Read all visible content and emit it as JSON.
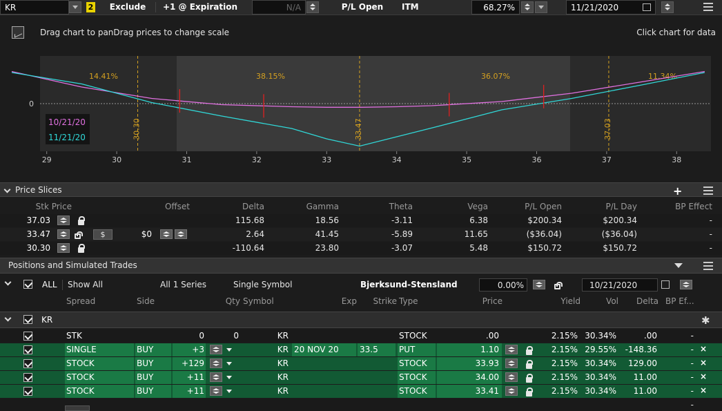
{
  "toolbar": {
    "symbol": "KR",
    "badge": "2",
    "exclude_label": "Exclude",
    "expiration_label": "+1 @ Expiration",
    "na_value": "N/A",
    "pl_open_label": "P/L Open",
    "itm_label": "ITM",
    "percent_value": "68.27%",
    "date_value": "11/21/2020"
  },
  "chart": {
    "title": "Drag chart to panDrag prices to change scale",
    "hint": "Click chart for data",
    "legend": [
      "10/21/20",
      "11/21/20"
    ],
    "zero_label": "0",
    "zone_labels": [
      "14.41%",
      "38.15%",
      "36.07%",
      "11.34%"
    ],
    "vertical_labels": [
      "30.30",
      "33.47",
      "37.03"
    ],
    "colors": {
      "today": "#e070e0",
      "expiration": "#30d8d8",
      "marker": "#d4a020",
      "strike": "#e02020"
    }
  },
  "chart_data": {
    "type": "line",
    "x_ticks": [
      29,
      30,
      31,
      32,
      33,
      34,
      35,
      36,
      37,
      38
    ],
    "xlim": [
      28.5,
      38.5
    ],
    "series": [
      {
        "name": "10/21/20",
        "x": [
          28.5,
          29.5,
          30.5,
          31.5,
          32.5,
          33.0,
          33.5,
          34.0,
          34.5,
          35.5,
          36.5,
          37.5,
          38.4
        ],
        "y": [
          0.62,
          0.32,
          0.1,
          -0.02,
          -0.06,
          -0.07,
          -0.07,
          -0.06,
          -0.04,
          0.04,
          0.2,
          0.42,
          0.62
        ]
      },
      {
        "name": "11/21/20",
        "x": [
          28.5,
          29.5,
          30.5,
          31.5,
          32.5,
          33.0,
          33.47,
          34.0,
          34.5,
          35.5,
          36.5,
          37.5,
          38.4
        ],
        "y": [
          0.6,
          0.38,
          0.02,
          -0.24,
          -0.48,
          -0.68,
          -0.82,
          -0.64,
          -0.47,
          -0.12,
          0.1,
          0.36,
          0.6
        ]
      }
    ]
  },
  "price_slices": {
    "title": "Price Slices",
    "headers": [
      "Stk Price",
      "Offset",
      "Delta",
      "Gamma",
      "Theta",
      "Vega",
      "P/L Open",
      "P/L Day",
      "BP Effect"
    ],
    "rows": [
      {
        "price": "37.03",
        "offset": "",
        "delta": "115.68",
        "gamma": "18.56",
        "theta": "-3.11",
        "vega": "6.38",
        "pl_open": "$200.34",
        "pl_day": "$200.34",
        "bp": "-"
      },
      {
        "price": "33.47",
        "offset": "$0",
        "delta": "2.64",
        "gamma": "41.45",
        "theta": "-5.89",
        "vega": "11.65",
        "pl_open": "($36.04)",
        "pl_day": "($36.04)",
        "bp": "-"
      },
      {
        "price": "30.30",
        "offset": "",
        "delta": "-110.64",
        "gamma": "23.80",
        "theta": "-3.07",
        "vega": "5.48",
        "pl_open": "$150.72",
        "pl_day": "$150.72",
        "bp": "-"
      }
    ],
    "dollar_symbol": "$"
  },
  "positions": {
    "title": "Positions and Simulated Trades",
    "filter": {
      "all_label": "ALL",
      "show_all": "Show All",
      "series": "All 1 Series",
      "symbol_mode": "Single Symbol",
      "model": "Bjerksund-Stensland",
      "rate": "0.00%",
      "date": "10/21/2020"
    },
    "headers": [
      "Spread",
      "Side",
      "Qty",
      "Symbol",
      "Exp",
      "Strike",
      "Type",
      "Price",
      "Yield",
      "Vol",
      "Delta",
      "BP Ef..."
    ],
    "group_label": "KR",
    "rows": [
      {
        "spread": "STK",
        "side": "",
        "qty": "0",
        "symbol": "KR",
        "exp": "",
        "strike": "",
        "type": "STOCK",
        "price": ".00",
        "yield": "2.15%",
        "vol": "30.34%",
        "delta": ".00",
        "bp": "-",
        "green": false
      },
      {
        "spread": "SINGLE",
        "side": "BUY",
        "qty": "+3",
        "symbol": "KR",
        "exp": "20 NOV 20",
        "strike": "33.5",
        "type": "PUT",
        "price": "1.10",
        "yield": "2.15%",
        "vol": "29.55%",
        "delta": "-148.36",
        "bp": "-",
        "green": true
      },
      {
        "spread": "STOCK",
        "side": "BUY",
        "qty": "+129",
        "symbol": "KR",
        "exp": "",
        "strike": "",
        "type": "STOCK",
        "price": "33.93",
        "yield": "2.15%",
        "vol": "30.34%",
        "delta": "129.00",
        "bp": "-",
        "green": true
      },
      {
        "spread": "STOCK",
        "side": "BUY",
        "qty": "+11",
        "symbol": "KR",
        "exp": "",
        "strike": "",
        "type": "STOCK",
        "price": "34.00",
        "yield": "2.15%",
        "vol": "30.34%",
        "delta": "11.00",
        "bp": "-",
        "green": true
      },
      {
        "spread": "STOCK",
        "side": "BUY",
        "qty": "+11",
        "symbol": "KR",
        "exp": "",
        "strike": "",
        "type": "STOCK",
        "price": "33.41",
        "yield": "2.15%",
        "vol": "30.34%",
        "delta": "11.00",
        "bp": "-",
        "green": true
      }
    ],
    "delete_symbol": "×",
    "trailing_bp": "-"
  }
}
